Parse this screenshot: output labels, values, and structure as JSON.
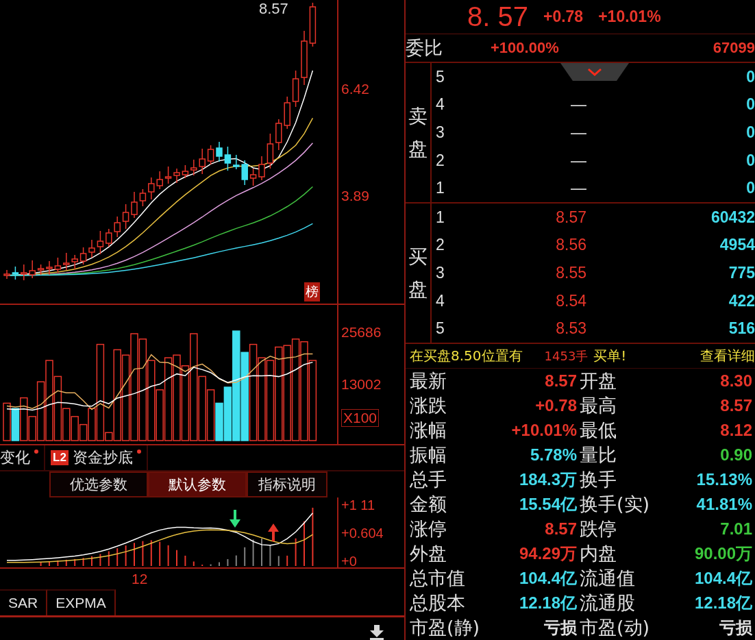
{
  "price_chart": {
    "high_label": "8.57",
    "axis_labels": [
      "6.42",
      "3.89"
    ],
    "badge": "榜"
  },
  "volume_chart": {
    "axis_labels": [
      "25686",
      "13002"
    ],
    "unit": "X100"
  },
  "indicator_tabs": [
    {
      "label": "变化",
      "alert": true
    },
    {
      "badge": "L2",
      "label": "资金抄底",
      "alert": true
    }
  ],
  "param_buttons": [
    {
      "label": "优选参数",
      "selected": false
    },
    {
      "label": "默认参数",
      "selected": true
    },
    {
      "label": "指标说明",
      "selected": false
    }
  ],
  "macd_chart": {
    "axis_labels": [
      "+1 11",
      "+0.604",
      "+0"
    ]
  },
  "x_axis_label": "12",
  "bottom_tabs": [
    "SAR",
    "EXPMA"
  ],
  "quote": {
    "price": "8. 57",
    "change": "+0.78",
    "percent": "+10.01%"
  },
  "order_ratio": {
    "label": "委比",
    "value": "+100.00%",
    "diff": "67099"
  },
  "sell": {
    "label": "卖盘",
    "rows": [
      {
        "rank": "5",
        "volume": "0"
      },
      {
        "rank": "4",
        "price": "—",
        "volume": "0"
      },
      {
        "rank": "3",
        "price": "—",
        "volume": "0"
      },
      {
        "rank": "2",
        "price": "—",
        "volume": "0"
      },
      {
        "rank": "1",
        "price": "—",
        "volume": "0"
      }
    ]
  },
  "buy": {
    "label": "买盘",
    "rows": [
      {
        "rank": "1",
        "price": "8.57",
        "volume": "60432"
      },
      {
        "rank": "2",
        "price": "8.56",
        "volume": "4954"
      },
      {
        "rank": "3",
        "price": "8.55",
        "volume": "775"
      },
      {
        "rank": "4",
        "price": "8.54",
        "volume": "422"
      },
      {
        "rank": "5",
        "price": "8.53",
        "volume": "516"
      }
    ]
  },
  "banner": {
    "prefix": "在买盘8.50位置有",
    "amount": "1453手",
    "suffix": "买单!",
    "link": "查看详细"
  },
  "stats": [
    {
      "label": "最新",
      "value": "8.57",
      "color": "#e8352a"
    },
    {
      "label": "开盘",
      "value": "8.30",
      "color": "#e8352a"
    },
    {
      "label": "涨跌",
      "value": "+0.78",
      "color": "#e8352a"
    },
    {
      "label": "最高",
      "value": "8.57",
      "color": "#e8352a"
    },
    {
      "label": "涨幅",
      "value": "+10.01%",
      "color": "#e8352a"
    },
    {
      "label": "最低",
      "value": "8.12",
      "color": "#e8352a"
    },
    {
      "label": "振幅",
      "value": "5.78%",
      "color": "#44dcec"
    },
    {
      "label": "量比",
      "value": "0.90",
      "color": "#3cc83c"
    },
    {
      "label": "总手",
      "value": "184.3万",
      "color": "#44dcec"
    },
    {
      "label": "换手",
      "value": "15.13%",
      "color": "#44dcec"
    },
    {
      "label": "金额",
      "value": "15.54亿",
      "color": "#44dcec"
    },
    {
      "label": "换手(实)",
      "value": "41.81%",
      "color": "#44dcec"
    },
    {
      "label": "涨停",
      "value": "8.57",
      "color": "#e8352a"
    },
    {
      "label": "跌停",
      "value": "7.01",
      "color": "#3cc83c"
    },
    {
      "label": "外盘",
      "value": "94.29万",
      "color": "#e8352a"
    },
    {
      "label": "内盘",
      "value": "90.00万",
      "color": "#3cc83c"
    },
    {
      "label": "总市值",
      "value": "104.4亿",
      "color": "#44dcec"
    },
    {
      "label": "流通值",
      "value": "104.4亿",
      "color": "#44dcec"
    },
    {
      "label": "总股本",
      "value": "12.18亿",
      "color": "#44dcec"
    },
    {
      "label": "流通股",
      "value": "12.18亿",
      "color": "#44dcec"
    },
    {
      "label": "市盈(静)",
      "value": "亏损",
      "color": "#e0e0e0"
    },
    {
      "label": "市盈(动)",
      "value": "亏损",
      "color": "#e0e0e0"
    }
  ]
}
